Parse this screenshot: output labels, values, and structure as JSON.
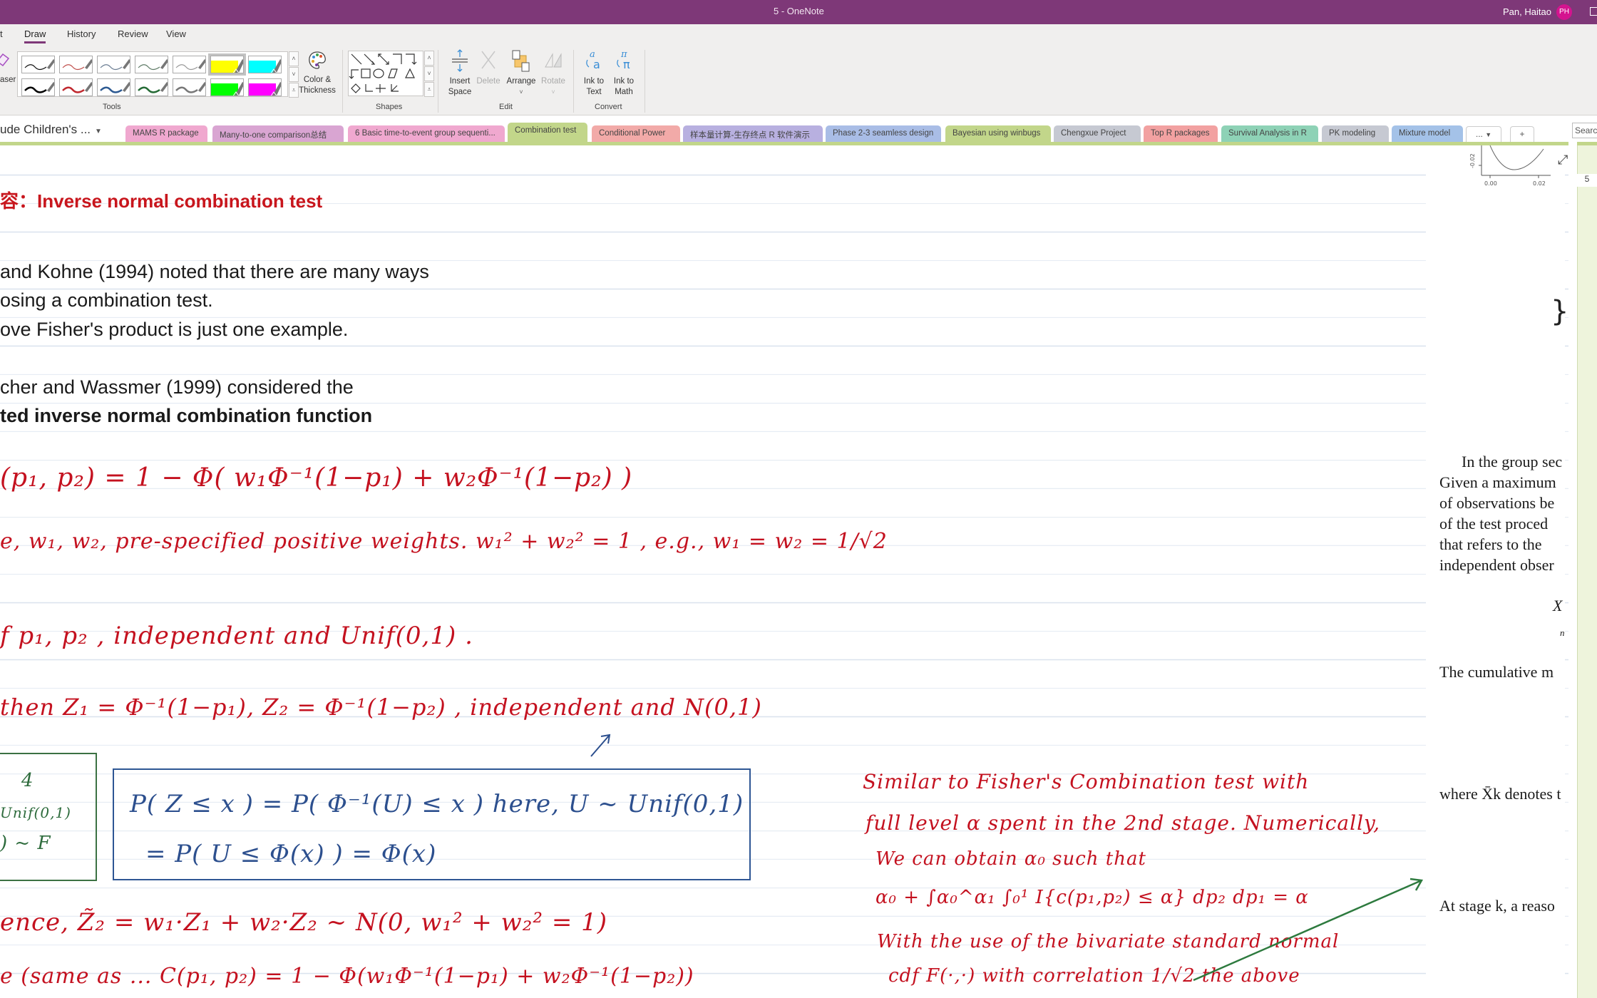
{
  "window": {
    "title": "5  -  OneNote",
    "user_name": "Pan, Haitao",
    "user_initials": "PH"
  },
  "ribbon_tabs": [
    {
      "label": "t",
      "active": false
    },
    {
      "label": "Draw",
      "active": true
    },
    {
      "label": "History",
      "active": false
    },
    {
      "label": "Review",
      "active": false
    },
    {
      "label": "View",
      "active": false
    }
  ],
  "ribbon": {
    "eraser_label": "aser",
    "tools_group_label": "Tools",
    "pens": [
      {
        "name": "black-pen-thin",
        "color": "#111111",
        "kind": "pen"
      },
      {
        "name": "red-pen-thin",
        "color": "#c0504d",
        "kind": "pen"
      },
      {
        "name": "blue-pen-thin",
        "color": "#6a7c92",
        "kind": "pen"
      },
      {
        "name": "green-pen-thin",
        "color": "#5e7a66",
        "kind": "pen"
      },
      {
        "name": "gray-pen-thin",
        "color": "#999999",
        "kind": "pen"
      },
      {
        "name": "yellow-highlighter",
        "color": "#ffff00",
        "kind": "highlighter",
        "selected": true
      },
      {
        "name": "cyan-highlighter",
        "color": "#00ffff",
        "kind": "highlighter"
      },
      {
        "name": "black-pen-thick",
        "color": "#000000",
        "kind": "pen"
      },
      {
        "name": "red-pen-thick",
        "color": "#c0282e",
        "kind": "pen"
      },
      {
        "name": "blue-pen-thick",
        "color": "#2d5a92",
        "kind": "pen"
      },
      {
        "name": "green-pen-thick",
        "color": "#256b35",
        "kind": "pen"
      },
      {
        "name": "gray-pen-thick",
        "color": "#777777",
        "kind": "pen"
      },
      {
        "name": "green-highlighter",
        "color": "#00ff00",
        "kind": "highlighter"
      },
      {
        "name": "magenta-highlighter",
        "color": "#ff00ff",
        "kind": "highlighter"
      }
    ],
    "color_thickness_label": "Color & Thickness",
    "shapes_group_label": "Shapes",
    "insert_space_label": "Insert Space",
    "delete_label": "Delete",
    "arrange_label": "Arrange",
    "rotate_label": "Rotate",
    "edit_group_label": "Edit",
    "ink_to_text_label": "Ink to Text",
    "ink_to_math_label": "Ink to Math",
    "convert_group_label": "Convert"
  },
  "notebook": {
    "name": "ude Children's ...",
    "search_placeholder": "Search"
  },
  "sections": [
    {
      "label": "MAMS R package",
      "color": "#f0a8cf"
    },
    {
      "label": "Many-to-one comparison总结",
      "color": "#d9a5d2"
    },
    {
      "label": "6 Basic time-to-event group sequenti...",
      "color": "#f0a8cf"
    },
    {
      "label": "Combination test",
      "color": "#c2d68a",
      "active": true
    },
    {
      "label": "Conditional Power",
      "color": "#f2aaa8"
    },
    {
      "label": "样本量计算-生存终点 R 软件演示",
      "color": "#b8b0e0"
    },
    {
      "label": "Phase 2-3 seamless design",
      "color": "#a9bde6"
    },
    {
      "label": "Bayesian using winbugs",
      "color": "#c2d68a"
    },
    {
      "label": "Chengxue Project",
      "color": "#c6c9d2"
    },
    {
      "label": "Top R packages",
      "color": "#f2a1a1"
    },
    {
      "label": "Survival Analysis in R",
      "color": "#8ed2b6"
    },
    {
      "label": "PK modeling",
      "color": "#c6c9d2"
    },
    {
      "label": "Mixture model",
      "color": "#a4c2e8"
    }
  ],
  "tabs_more_label": "...",
  "tabs_add_label": "+",
  "page_number": "5",
  "content": {
    "heading": "容：Inverse normal combination test",
    "paragraph1": [
      "and Kohne (1994) noted that there are many ways",
      "osing a combination test.",
      "ove Fisher's product is just one example."
    ],
    "paragraph2": [
      "cher and Wassmer (1999) considered the",
      "ted inverse normal combination function"
    ],
    "ink_lines": [
      "(p₁, p₂) = 1 − Φ( w₁Φ⁻¹(1−p₁) + w₂Φ⁻¹(1−p₂) )",
      "e,   w₁, w₂,  pre-specified  positive weights.   w₁² + w₂² = 1 ,  e.g., w₁ = w₂ = 1/√2",
      "f    p₁, p₂ ,  independent  and  Unif(0,1) .",
      "then   Z₁ = Φ⁻¹(1−p₁),  Z₂ = Φ⁻¹(1−p₂) ,  independent  and  N(0,1)",
      "ence,   Z̃₂ = w₁·Z₁ + w₂·Z₂   ~ N(0,  w₁² + w₂² = 1)",
      "e  (same as  ...   C(p₁, p₂) = 1 − Φ(w₁Φ⁻¹(1−p₁) + w₂Φ⁻¹(1−p₂))"
    ],
    "blue_box_lines": [
      "P( Z  ≤ x ) = P( Φ⁻¹(U) ≤ x )    here,  U ~ Unif(0,1)",
      "= P( U ≤ Φ(x) ) = Φ(x)"
    ],
    "green_box_lines": [
      "4",
      "Unif(0,1)",
      ") ~ F"
    ],
    "note_lines": [
      "Similar to Fisher's Combination test with",
      "full level α spent in the 2nd stage. Numerically,",
      "We can obtain α₀ such that",
      "α₀ + ∫α₀^α₁ ∫₀¹ I{c(p₁,p₂) ≤ α} dp₂ dp₁ = α",
      "With the use of the bivariate standard normal",
      "cdf F(·,·) with correlation 1/√2  the above"
    ]
  },
  "book_excerpt": {
    "plot_ytick": "-0.02",
    "plot_xticks": [
      "0.00",
      "0.02"
    ],
    "lines": [
      "In the group sec",
      "Given a maximum",
      "of observations be",
      "of the test proced",
      "that refers to the",
      "independent obser"
    ],
    "formula_fragment": "X",
    "formula_sub": "n",
    "cumulative_line": "The cumulative m",
    "where_line": "where X̄k denotes t",
    "stage_line": "At stage k, a reaso"
  }
}
